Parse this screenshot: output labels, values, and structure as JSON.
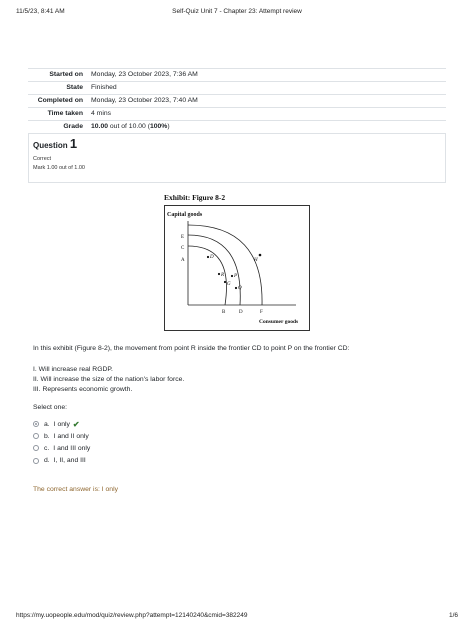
{
  "print_header": {
    "datetime": "11/5/23, 8:41 AM",
    "page_title": "Self-Quiz Unit 7 - Chapter 23: Attempt review"
  },
  "summary": {
    "rows": [
      {
        "label": "Started on",
        "value": "Monday, 23 October 2023, 7:36 AM"
      },
      {
        "label": "State",
        "value": "Finished"
      },
      {
        "label": "Completed on",
        "value": "Monday, 23 October 2023, 7:40 AM"
      },
      {
        "label": "Time taken",
        "value": "4 mins"
      }
    ],
    "grade_label": "Grade",
    "grade_score": "10.00",
    "grade_rest": " out of 10.00 (",
    "grade_percent": "100%",
    "grade_close": ")"
  },
  "question": {
    "prefix": "Question ",
    "number": "1",
    "state": "Correct",
    "mark": "Mark 1.00 out of 1.00"
  },
  "figure": {
    "title": "Exhibit: Figure 8-2",
    "y_axis_label": "Capital goods",
    "x_axis_label": "Consumer goods",
    "y_ticks": [
      "E",
      "C",
      "A"
    ],
    "x_ticks": [
      "B",
      "D",
      "F"
    ],
    "point_labels": [
      "R",
      "P",
      "Q",
      "H",
      "G"
    ]
  },
  "question_text": "In this exhibit (Figure 8-2), the movement from point R inside the frontier CD to point P on the frontier CD:",
  "statements": [
    "I. Will increase real RGDP.",
    "II. Will increase the size of the nation's labor force.",
    "III. Represents economic growth."
  ],
  "select_one": "Select one:",
  "options": [
    {
      "letter": "a.",
      "text": "I only"
    },
    {
      "letter": "b.",
      "text": "I and II only"
    },
    {
      "letter": "c.",
      "text": "I and III only"
    },
    {
      "letter": "d.",
      "text": "I, II, and III"
    }
  ],
  "feedback": "The correct answer is: I only",
  "print_footer": {
    "url": "https://my.uopeople.edu/mod/quiz/review.php?attempt=12140240&cmid=382249",
    "page": "1/6"
  }
}
